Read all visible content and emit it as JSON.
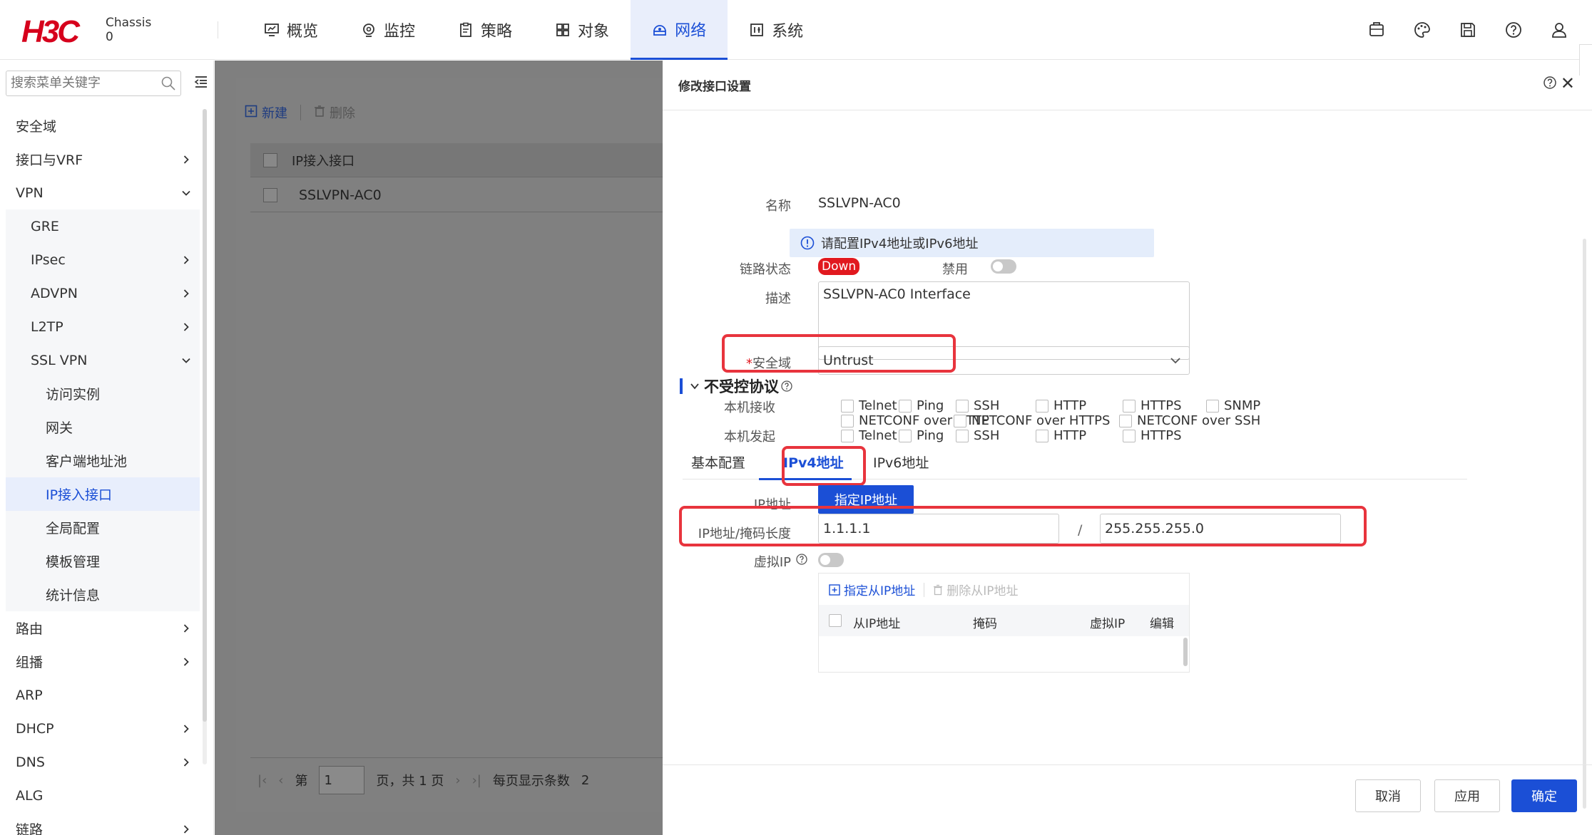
{
  "header": {
    "logo": "H3C",
    "device_name": "Chassis",
    "device_id": "0",
    "nav": [
      {
        "label": "概览",
        "icon": "dashboard-icon"
      },
      {
        "label": "监控",
        "icon": "monitor-icon"
      },
      {
        "label": "策略",
        "icon": "policy-icon"
      },
      {
        "label": "对象",
        "icon": "object-icon"
      },
      {
        "label": "网络",
        "icon": "network-icon",
        "active": true
      },
      {
        "label": "系统",
        "icon": "system-icon"
      }
    ],
    "right_icons": [
      "message-icon",
      "theme-icon",
      "save-icon",
      "help-icon",
      "user-icon"
    ]
  },
  "sidebar": {
    "search_placeholder": "搜索菜单关键字",
    "items": [
      {
        "label": "安全域",
        "level": 0
      },
      {
        "label": "接口与VRF",
        "level": 0,
        "arrow": "right"
      },
      {
        "label": "VPN",
        "level": 0,
        "arrow": "down"
      },
      {
        "label": "GRE",
        "level": 1
      },
      {
        "label": "IPsec",
        "level": 1,
        "arrow": "right"
      },
      {
        "label": "ADVPN",
        "level": 1,
        "arrow": "right"
      },
      {
        "label": "L2TP",
        "level": 1,
        "arrow": "right"
      },
      {
        "label": "SSL VPN",
        "level": 1,
        "arrow": "down"
      },
      {
        "label": "访问实例",
        "level": 2
      },
      {
        "label": "网关",
        "level": 2
      },
      {
        "label": "客户端地址池",
        "level": 2
      },
      {
        "label": "IP接入接口",
        "level": 2,
        "selected": true
      },
      {
        "label": "全局配置",
        "level": 2
      },
      {
        "label": "模板管理",
        "level": 2
      },
      {
        "label": "统计信息",
        "level": 2
      },
      {
        "label": "路由",
        "level": 0,
        "arrow": "right"
      },
      {
        "label": "组播",
        "level": 0,
        "arrow": "right"
      },
      {
        "label": "ARP",
        "level": 0
      },
      {
        "label": "DHCP",
        "level": 0,
        "arrow": "right"
      },
      {
        "label": "DNS",
        "level": 0,
        "arrow": "right"
      },
      {
        "label": "ALG",
        "level": 0
      },
      {
        "label": "链路",
        "level": 0,
        "arrow": "right"
      }
    ]
  },
  "list_page": {
    "new_label": "新建",
    "delete_label": "删除",
    "column_header": "IP接入接口",
    "rows": [
      "SSLVPN-AC0"
    ],
    "pager": {
      "prefix": "第",
      "page": "1",
      "suffix": "页，共 1 页",
      "page_size_label": "每页显示条数",
      "page_size_partial": "2"
    }
  },
  "drawer": {
    "title": "修改接口设置",
    "name_label": "名称",
    "name_value": "SSLVPN-AC0",
    "info_text": "请配置IPv4地址或IPv6地址",
    "link_status_label": "链路状态",
    "link_status_value": "Down",
    "disable_label": "禁用",
    "desc_label": "描述",
    "desc_value": "SSLVPN-AC0 Interface",
    "zone_label_required": "*",
    "zone_label": "安全域",
    "zone_value": "Untrust",
    "section_title": "不受控协议",
    "local_recv_label": "本机接收",
    "local_recv": [
      "Telnet",
      "Ping",
      "SSH",
      "HTTP",
      "HTTPS",
      "SNMP"
    ],
    "local_recv_row2": [
      "NETCONF over HTTP",
      "NETCONF over HTTPS",
      "NETCONF over SSH"
    ],
    "local_send_label": "本机发起",
    "local_send": [
      "Telnet",
      "Ping",
      "SSH",
      "HTTP",
      "HTTPS"
    ],
    "tabs": [
      "基本配置",
      "IPv4地址",
      "IPv6地址"
    ],
    "active_tab": "IPv4地址",
    "ip_label": "IP地址",
    "ip_mode_button": "指定IP地址",
    "ip_mask_label": "IP地址/掩码长度",
    "ip_value": "1.1.1.1",
    "mask_sep": "/",
    "mask_value": "255.255.255.0",
    "virtual_ip_label": "虚拟IP",
    "sub_add": "指定从IP地址",
    "sub_delete": "删除从IP地址",
    "sub_columns": [
      "从IP地址",
      "掩码",
      "虚拟IP",
      "编辑"
    ],
    "footer": {
      "cancel": "取消",
      "apply": "应用",
      "ok": "确定"
    }
  },
  "colors": {
    "accent": "#1b4fd6",
    "brand": "#d6001c",
    "highlight_box": "#e8343d",
    "status_down": "#e1191f"
  }
}
